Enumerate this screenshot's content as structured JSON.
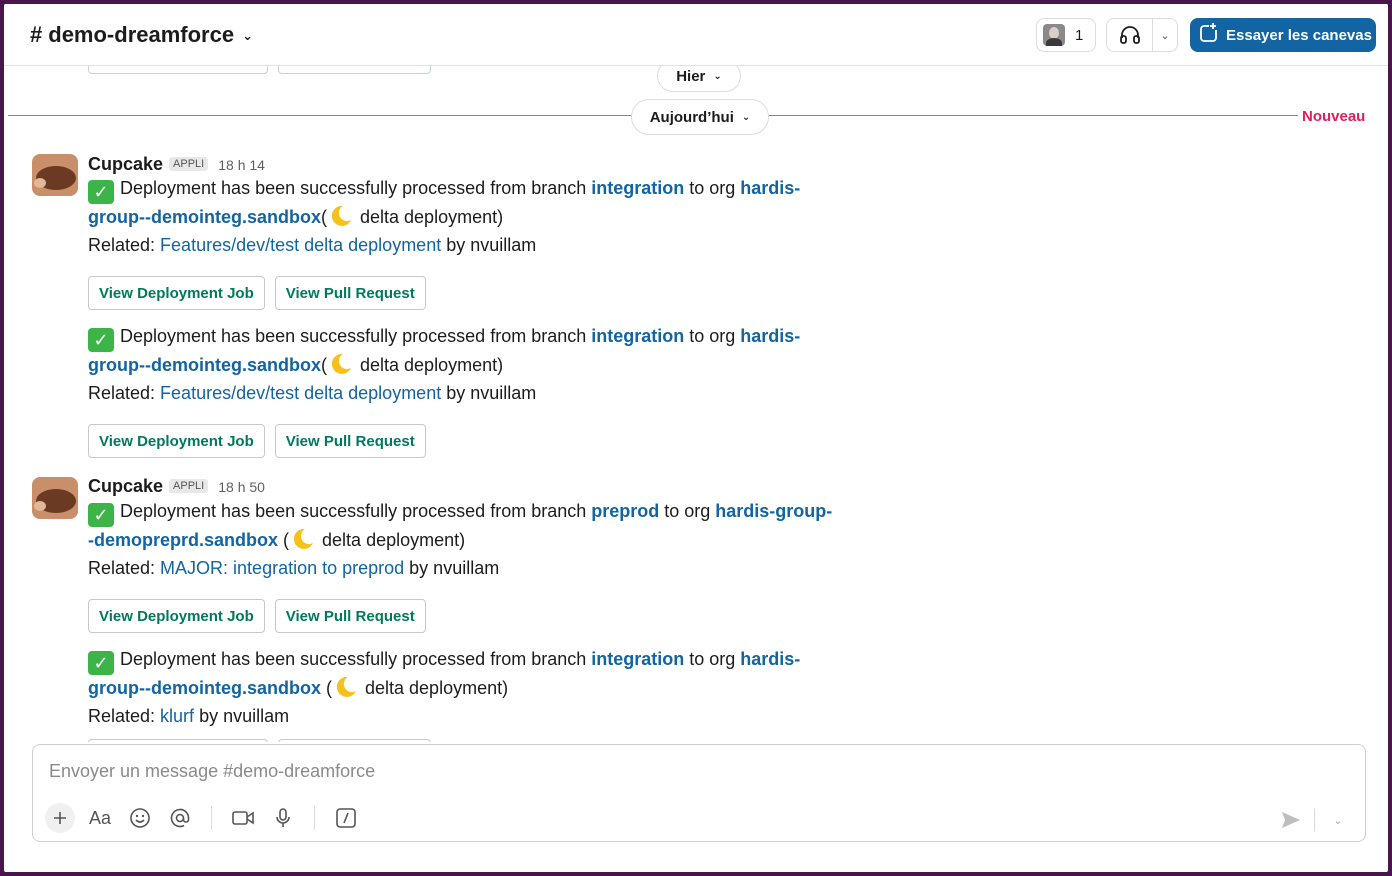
{
  "header": {
    "hash": "#",
    "channel_name": "demo-dreamforce",
    "member_count": "1",
    "canvas_button_label": "Essayer les canevas"
  },
  "dividers": {
    "yesterday": "Hier",
    "today": "Aujourd’hui",
    "new_label": "Nouveau"
  },
  "messages": [
    {
      "author": "Cupcake",
      "badge": "APPLI",
      "time": "18 h 14",
      "posts": [
        {
          "line1_pre": "Deployment has been successfully processed from branch ",
          "branch": "integration",
          "mid": " to org ",
          "org": "hardis-group--demointeg.sandbox",
          "org_part1": "hardis-",
          "org_part2": "group--demointeg.sandbox",
          "after_org": "(",
          "tail": " delta deployment)",
          "related_label": "Related: ",
          "related_link": "Features/dev/test delta deployment",
          "related_by": " by nvuillam",
          "btn_job": "View Deployment Job",
          "btn_pr": "View Pull Request"
        },
        {
          "line1_pre": "Deployment has been successfully processed from branch ",
          "branch": "integration",
          "mid": " to org ",
          "org_part1": "hardis-",
          "org_part2": "group--demointeg.sandbox",
          "after_org": "(",
          "tail": " delta deployment)",
          "related_label": "Related: ",
          "related_link": "Features/dev/test delta deployment",
          "related_by": " by nvuillam",
          "btn_job": "View Deployment Job",
          "btn_pr": "View Pull Request"
        }
      ]
    },
    {
      "author": "Cupcake",
      "badge": "APPLI",
      "time": "18 h 50",
      "posts": [
        {
          "line1_pre": "Deployment has been successfully processed from branch ",
          "branch": "preprod",
          "mid": " to org ",
          "org_part1": "hardis-group-",
          "org_part2": "-demopreprd.sandbox",
          "after_org": " (",
          "tail": " delta deployment)",
          "related_label": "Related: ",
          "related_link": "MAJOR: integration to preprod",
          "related_by": " by nvuillam",
          "btn_job": "View Deployment Job",
          "btn_pr": "View Pull Request"
        },
        {
          "line1_pre": "Deployment has been successfully processed from branch ",
          "branch": "integration",
          "mid": " to org ",
          "org_part1": "hardis-",
          "org_part2": "group--demointeg.sandbox",
          "after_org": " (",
          "tail": " delta deployment)",
          "related_label": "Related: ",
          "related_link": "klurf",
          "related_by": " by nvuillam"
        }
      ]
    }
  ],
  "composer": {
    "placeholder": "Envoyer un message #demo-dreamforce",
    "format_label": "Aa"
  },
  "colors": {
    "accent": "#1264a3",
    "button_text": "#007a5a",
    "new_divider": "#e01e5a",
    "workspace": "#4a154b"
  },
  "icons": [
    "chevron-down-icon",
    "headphones-icon",
    "canvas-icon",
    "check-emoji-icon",
    "moon-emoji-icon",
    "plus-icon",
    "emoji-icon",
    "mention-icon",
    "video-icon",
    "microphone-icon",
    "slash-command-icon",
    "send-icon"
  ]
}
